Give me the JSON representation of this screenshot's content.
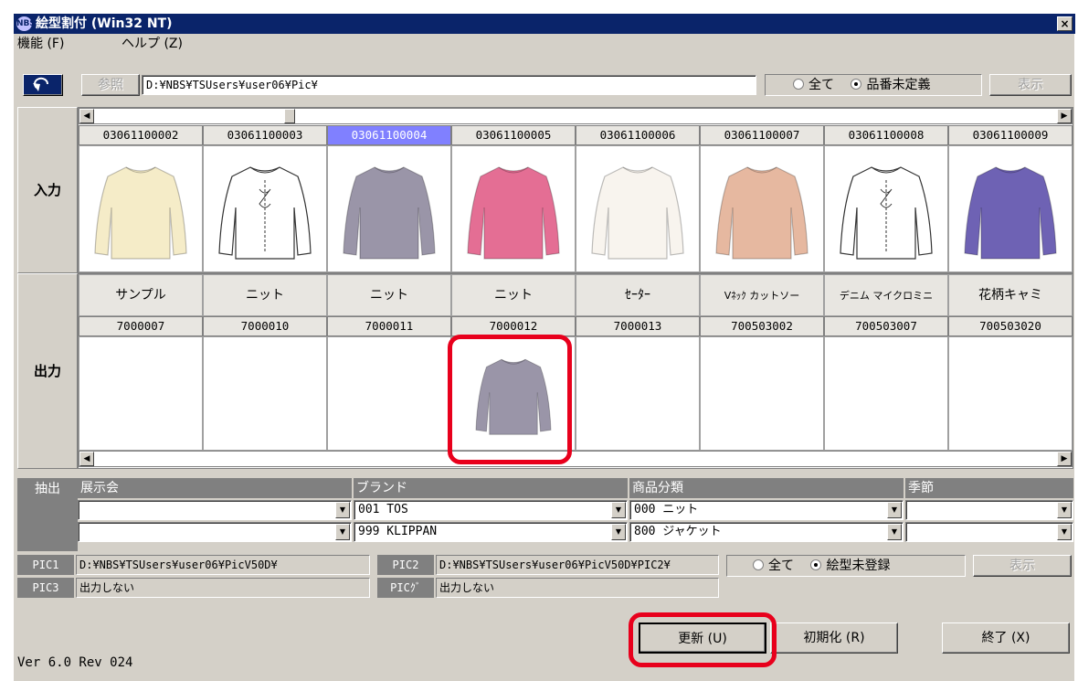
{
  "window": {
    "title": "絵型割付 (Win32 NT)",
    "icon": "nbs-app-icon",
    "close": "×"
  },
  "menu": {
    "function": "機能 (F)",
    "help": "ヘルプ (Z)"
  },
  "toolbar": {
    "back_icon": "back-arrow-icon",
    "browse_label": "参照",
    "path": "D:¥NBS¥TSUsers¥user06¥Pic¥",
    "radio_all": "全て",
    "radio_undefined": "品番未定義",
    "radio_selected": "品番未定義",
    "show_label": "表示"
  },
  "input_label": "入力",
  "output_label": "出力",
  "input_items": [
    {
      "code": "03061100002",
      "image": "cream-sweater-photo",
      "color": "#f5ecc8"
    },
    {
      "code": "03061100003",
      "image": "cardigan-sketch",
      "color": "#ffffff"
    },
    {
      "code": "03061100004",
      "image": "gray-knit-photo",
      "color": "#9a95a8",
      "selected": true
    },
    {
      "code": "03061100005",
      "image": "pink-top-photo",
      "color": "#e46e94"
    },
    {
      "code": "03061100006",
      "image": "white-cardigan-photo",
      "color": "#f8f4ee"
    },
    {
      "code": "03061100007",
      "image": "beige-jacket-photo",
      "color": "#e6b8a0"
    },
    {
      "code": "03061100008",
      "image": "cardigan-sketch-2",
      "color": "#ffffff"
    },
    {
      "code": "03061100009",
      "image": "purple-knit-photo",
      "color": "#6e62b4"
    }
  ],
  "output_items": [
    {
      "name": "サンプル",
      "code": "7000007",
      "image": ""
    },
    {
      "name": "ニット",
      "code": "7000010",
      "image": ""
    },
    {
      "name": "ニット",
      "code": "7000011",
      "image": ""
    },
    {
      "name": "ニット",
      "code": "7000012",
      "image": "gray-knit-photo"
    },
    {
      "name": "ｾｰﾀｰ",
      "code": "7000013",
      "image": ""
    },
    {
      "name": "Vﾈｯｸ カットソー",
      "code": "700503002",
      "image": ""
    },
    {
      "name": "デニム マイクロミニ",
      "code": "700503007",
      "image": ""
    },
    {
      "name": "花柄キャミ",
      "code": "700503020",
      "image": ""
    }
  ],
  "filter": {
    "label": "抽出",
    "columns": [
      "展示会",
      "ブランド",
      "商品分類",
      "季節"
    ],
    "row1": [
      "",
      "001 TOS",
      "000 ニット",
      ""
    ],
    "row2": [
      "",
      "999 KLIPPAN",
      "800 ジャケット",
      ""
    ]
  },
  "pics": {
    "pic1_label": "PIC1",
    "pic1_value": "D:¥NBS¥TSUsers¥user06¥PicV50D¥",
    "pic2_label": "PIC2",
    "pic2_value": "D:¥NBS¥TSUsers¥user06¥PicV50D¥PIC2¥",
    "pic3_label": "PIC3",
    "pic3_value": "出力しない",
    "picg_label": "PICｸﾞ",
    "picg_value": "出力しない",
    "radio_all": "全て",
    "radio_unregistered": "絵型未登録",
    "radio_selected": "絵型未登録",
    "show_label": "表示"
  },
  "buttons": {
    "update": "更新 (U)",
    "init": "初期化 (R)",
    "exit": "終了 (X)"
  },
  "version": "Ver 6.0  Rev 024",
  "colors": {
    "titlebar": "#0a246a",
    "selected_code": "#8080ff",
    "highlight": "#e8001c"
  }
}
